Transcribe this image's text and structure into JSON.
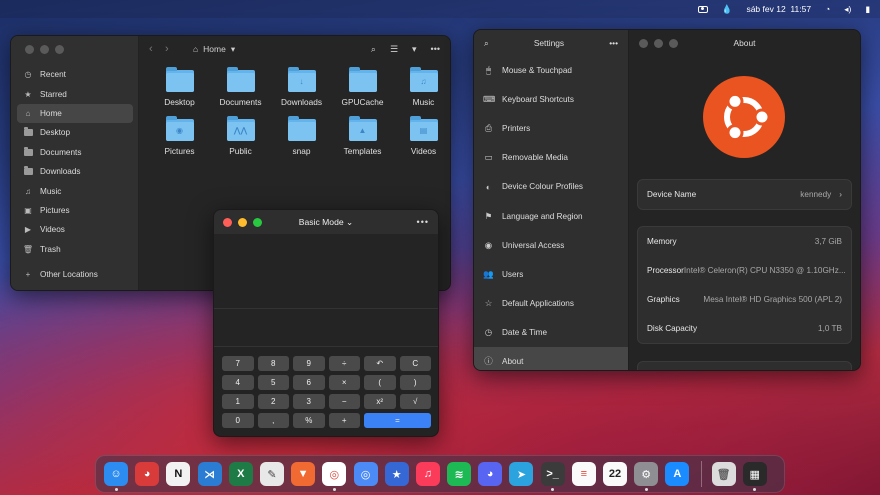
{
  "topbar": {
    "date": "sáb fev 12",
    "time": "11:57",
    "icons": [
      "apple-icon",
      "camera-icon",
      "drop-icon",
      "wifi-icon",
      "volume-icon",
      "battery-icon"
    ]
  },
  "files": {
    "path_label": "Home",
    "sidebar": [
      {
        "label": "Recent",
        "icon": "clock-icon"
      },
      {
        "label": "Starred",
        "icon": "star-icon"
      },
      {
        "label": "Home",
        "icon": "home-icon"
      },
      {
        "label": "Desktop",
        "icon": "folder-icon"
      },
      {
        "label": "Documents",
        "icon": "folder-icon"
      },
      {
        "label": "Downloads",
        "icon": "folder-icon"
      },
      {
        "label": "Music",
        "icon": "music-icon"
      },
      {
        "label": "Pictures",
        "icon": "image-icon"
      },
      {
        "label": "Videos",
        "icon": "video-icon"
      },
      {
        "label": "Trash",
        "icon": "trash-icon"
      },
      {
        "label": "Other Locations",
        "icon": "plus-icon"
      }
    ],
    "folders": [
      {
        "label": "Desktop",
        "glyph": ""
      },
      {
        "label": "Documents",
        "glyph": ""
      },
      {
        "label": "Downloads",
        "glyph": "↓"
      },
      {
        "label": "GPUCache",
        "glyph": ""
      },
      {
        "label": "Music",
        "glyph": "♫"
      },
      {
        "label": "Pictures",
        "glyph": "◉"
      },
      {
        "label": "Public",
        "glyph": "⋀⋀"
      },
      {
        "label": "snap",
        "glyph": ""
      },
      {
        "label": "Templates",
        "glyph": "▲"
      },
      {
        "label": "Videos",
        "glyph": "▤"
      }
    ]
  },
  "calculator": {
    "mode_label": "Basic Mode",
    "keys": [
      "7",
      "8",
      "9",
      "÷",
      "↶",
      "C",
      "4",
      "5",
      "6",
      "×",
      "(",
      ")",
      "1",
      "2",
      "3",
      "−",
      "x²",
      "√",
      "0",
      ",",
      "%",
      "+",
      "="
    ]
  },
  "settings": {
    "title": "Settings",
    "about_title": "About",
    "items": [
      {
        "label": "Mouse & Touchpad",
        "icon": "mouse-icon",
        "glyph": "🖱"
      },
      {
        "label": "Keyboard Shortcuts",
        "icon": "keyboard-icon",
        "glyph": "⌨"
      },
      {
        "label": "Printers",
        "icon": "printer-icon",
        "glyph": "⎙"
      },
      {
        "label": "Removable Media",
        "icon": "media-icon",
        "glyph": "▭"
      },
      {
        "label": "Device Colour Profiles",
        "icon": "color-profile-icon",
        "glyph": "◐"
      },
      {
        "label": "Language and Region",
        "icon": "flag-icon",
        "glyph": "⚑"
      },
      {
        "label": "Universal Access",
        "icon": "accessibility-icon",
        "glyph": "◉"
      },
      {
        "label": "Users",
        "icon": "users-icon",
        "glyph": "👥"
      },
      {
        "label": "Default Applications",
        "icon": "star-icon",
        "glyph": "☆"
      },
      {
        "label": "Date & Time",
        "icon": "clock-icon",
        "glyph": "◷"
      },
      {
        "label": "About",
        "icon": "info-icon",
        "glyph": "ⓘ"
      }
    ],
    "device_name": {
      "label": "Device Name",
      "value": "kennedy"
    },
    "specs": [
      {
        "label": "Memory",
        "value": "3,7 GiB"
      },
      {
        "label": "Processor",
        "value": "Intel® Celeron(R) CPU N3350 @ 1.10GHz..."
      },
      {
        "label": "Graphics",
        "value": "Mesa Intel® HD Graphics 500 (APL 2)"
      },
      {
        "label": "Disk Capacity",
        "value": "1,0 TB"
      }
    ],
    "ubuntu_color": "#e95420"
  },
  "dock": {
    "apps": [
      {
        "name": "finder",
        "glyph": "☺",
        "bg": "#2d8cf0",
        "running": true
      },
      {
        "name": "ghost",
        "glyph": "◕",
        "bg": "#d93b3b",
        "running": false
      },
      {
        "name": "notion",
        "glyph": "N",
        "bg": "#f2f2f2",
        "fg": "#111",
        "running": false
      },
      {
        "name": "vscode",
        "glyph": "⋊",
        "bg": "#2b7cd3",
        "running": false
      },
      {
        "name": "excel",
        "glyph": "X",
        "bg": "#1e7b45",
        "running": false
      },
      {
        "name": "notes",
        "glyph": "✎",
        "bg": "#e8e8e8",
        "fg": "#444",
        "running": false
      },
      {
        "name": "brave",
        "glyph": "▼",
        "bg": "#f06a32",
        "running": false
      },
      {
        "name": "chrome",
        "glyph": "◎",
        "bg": "#ffffff",
        "fg": "#d9473b",
        "running": true
      },
      {
        "name": "chromium",
        "glyph": "◎",
        "bg": "#4c8bf5",
        "running": false
      },
      {
        "name": "starred",
        "glyph": "★",
        "bg": "#3568d4",
        "running": false
      },
      {
        "name": "music",
        "glyph": "♫",
        "bg": "#fa3b5a",
        "running": false
      },
      {
        "name": "spotify",
        "glyph": "≋",
        "bg": "#1db954",
        "running": false
      },
      {
        "name": "discord",
        "glyph": "◕",
        "bg": "#5865f2",
        "running": false
      },
      {
        "name": "telegram",
        "glyph": "➤",
        "bg": "#2aa3de",
        "running": false
      },
      {
        "name": "terminal",
        "glyph": ">_",
        "bg": "#3b3b3b",
        "running": true
      },
      {
        "name": "reminders",
        "glyph": "≡",
        "bg": "#fafafa",
        "fg": "#e84b3c",
        "running": false
      },
      {
        "name": "calendar",
        "glyph": "22",
        "bg": "#fafafa",
        "fg": "#222",
        "running": false
      },
      {
        "name": "settings",
        "glyph": "⚙",
        "bg": "#8e8e93",
        "running": true
      },
      {
        "name": "appstore",
        "glyph": "A",
        "bg": "#1a8cff",
        "running": false
      }
    ],
    "trailing": [
      {
        "name": "trash",
        "glyph": "🗑",
        "bg": "#dcdcdc",
        "fg": "#666",
        "running": false
      },
      {
        "name": "calculator",
        "glyph": "▦",
        "bg": "#2a2a2a",
        "running": true
      }
    ]
  }
}
